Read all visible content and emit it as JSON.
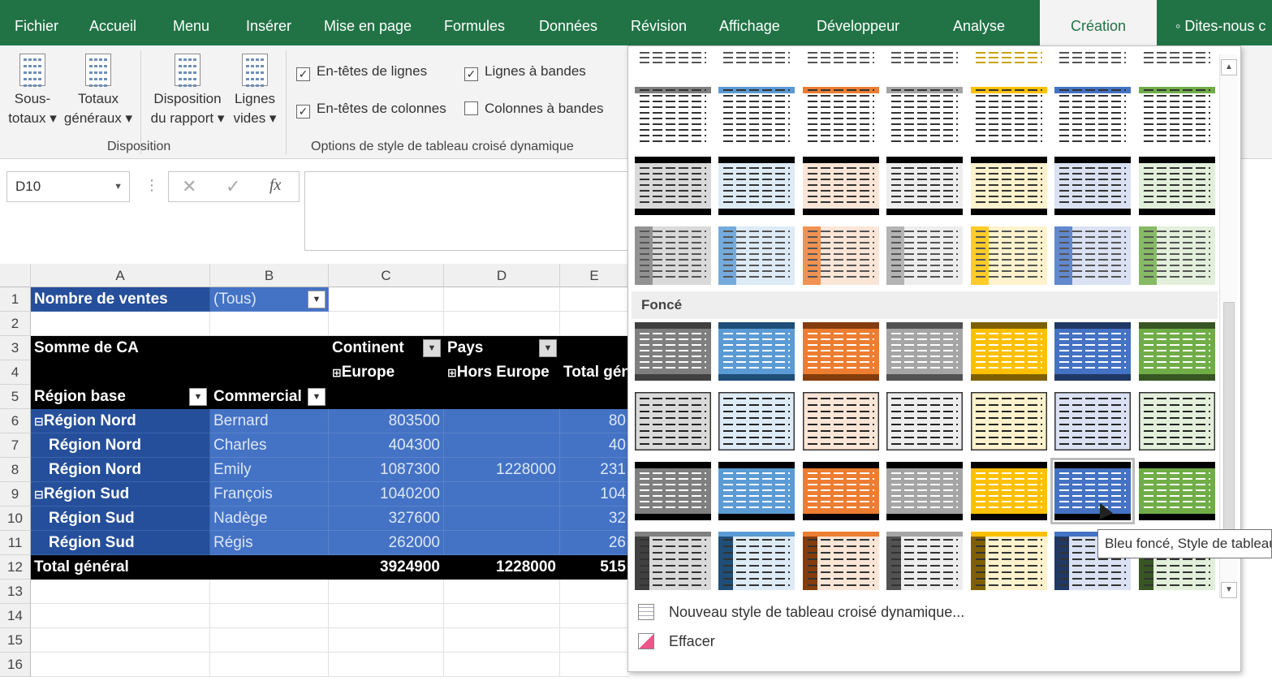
{
  "ribbon_tabs": [
    "Fichier",
    "Accueil",
    "Menu",
    "Insérer",
    "Mise en page",
    "Formules",
    "Données",
    "Révision",
    "Affichage",
    "Développeur",
    "Analyse",
    "Création",
    "Dites-nous c"
  ],
  "active_tab": "Création",
  "ribbon": {
    "subtotals": [
      "Sous-",
      "totaux ▾"
    ],
    "grand_totals": [
      "Totaux",
      "généraux ▾"
    ],
    "report_layout": [
      "Disposition",
      "du rapport ▾"
    ],
    "blank_rows": [
      "Lignes",
      "vides ▾"
    ],
    "group_layout": "Disposition",
    "opt_row_headers": "En-têtes de lignes",
    "opt_col_headers": "En-têtes de colonnes",
    "opt_banded_rows": "Lignes à bandes",
    "opt_banded_cols": "Colonnes à bandes",
    "group_style_options": "Options de style de tableau croisé dynamique",
    "checks": {
      "row_headers": true,
      "col_headers": true,
      "banded_rows": true,
      "banded_cols": false
    }
  },
  "formula_bar": {
    "name_box": "D10",
    "fx": "fx",
    "cancel": "✕",
    "enter": "✓",
    "formula": ""
  },
  "columns": [
    "A",
    "B",
    "C",
    "D",
    "E"
  ],
  "rows": [
    "1",
    "2",
    "3",
    "4",
    "5",
    "6",
    "7",
    "8",
    "9",
    "10",
    "11",
    "12",
    "13",
    "14",
    "15",
    "16"
  ],
  "pivot": {
    "filter_label": "Nombre de ventes",
    "filter_value": "(Tous)",
    "values_label": "Somme de CA",
    "col_field": "Continent",
    "col_field2": "Pays",
    "col_europe": "Europe",
    "col_hors": "Hors Europe",
    "col_total": "Total gén",
    "row_field": "Région base",
    "row_field2": "Commercial",
    "data_rows": [
      {
        "region": "Région Nord",
        "expand": true,
        "name": "Bernard",
        "europe": "803500",
        "hors": "",
        "total": "80"
      },
      {
        "region": "Région Nord",
        "expand": false,
        "name": "Charles",
        "europe": "404300",
        "hors": "",
        "total": "40"
      },
      {
        "region": "Région Nord",
        "expand": false,
        "name": "Emily",
        "europe": "1087300",
        "hors": "1228000",
        "total": "231"
      },
      {
        "region": "Région Sud",
        "expand": true,
        "name": "François",
        "europe": "1040200",
        "hors": "",
        "total": "104"
      },
      {
        "region": "Région Sud",
        "expand": false,
        "name": "Nadège",
        "europe": "327600",
        "hors": "",
        "total": "32"
      },
      {
        "region": "Région Sud",
        "expand": false,
        "name": "Régis",
        "europe": "262000",
        "hors": "",
        "total": "26"
      }
    ],
    "total_label": "Total général",
    "total_europe": "3924900",
    "total_hors": "1228000",
    "total_total": "515"
  },
  "gallery": {
    "section_dark": "Foncé",
    "palettes": [
      "#7f7f7f",
      "#5b9bd5",
      "#ed7d31",
      "#a5a5a5",
      "#ffc000",
      "#4472c4",
      "#70ad47"
    ],
    "palette_dark": [
      "#404040",
      "#1f4e79",
      "#843c0c",
      "#525252",
      "#7f6000",
      "#203864",
      "#375623"
    ],
    "palette_light": [
      "#d9d9d9",
      "#ddebf7",
      "#fbe5d6",
      "#ededed",
      "#fff2cc",
      "#d9e1f2",
      "#e2efda"
    ],
    "new_style": "Nouveau style de tableau croisé dynamique...",
    "clear": "Effacer",
    "tooltip": "Bleu foncé, Style de tableau"
  }
}
